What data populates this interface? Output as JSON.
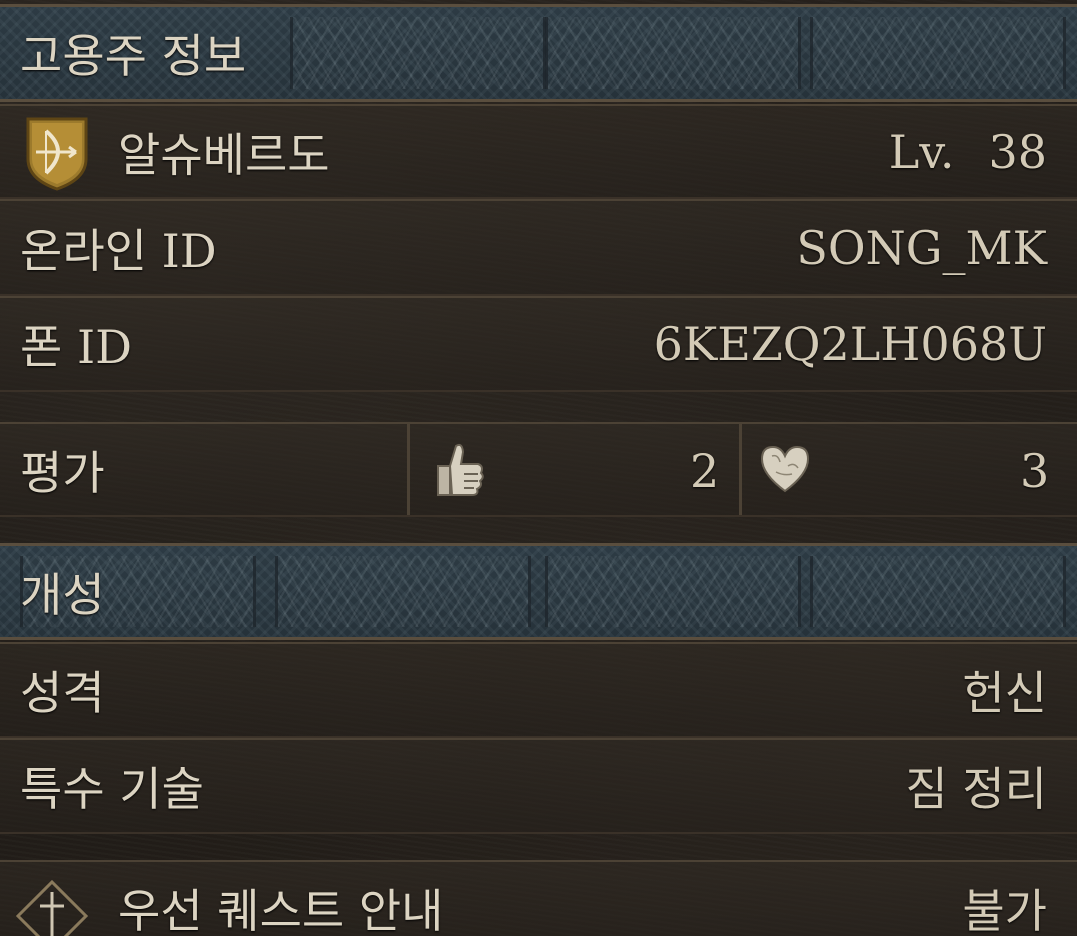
{
  "employer_section": {
    "title": "고용주 정보",
    "character_name": "알슈베르도",
    "level_label": "Lv.",
    "level_value": "38",
    "online_id_label": "온라인 ID",
    "online_id_value": "SONG_MK",
    "pawn_id_label": "폰 ID",
    "pawn_id_value": "6KEZQ2LH068U",
    "rating_label": "평가",
    "thumbs_up_count": "2",
    "heart_count": "3",
    "class_icon": "bow-crest-icon"
  },
  "personality_section": {
    "title": "개성",
    "personality_label": "성격",
    "personality_value": "헌신",
    "special_skill_label": "특수 기술",
    "special_skill_value": "짐 정리",
    "quest_guide_label": "우선 퀘스트 안내",
    "quest_guide_value": "불가",
    "quest_icon": "sword-diamond-icon"
  },
  "colors": {
    "header_bg": "#2d3b44",
    "text": "#d9d0bd",
    "border": "#4c4235"
  }
}
